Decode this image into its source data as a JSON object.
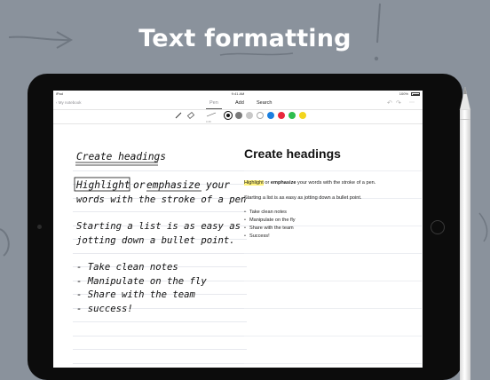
{
  "headline": "Text formatting",
  "statusbar": {
    "device": "iPad",
    "time": "9:41 AM",
    "battery": "100%"
  },
  "navbar": {
    "back_label": "My notebook",
    "tabs": [
      "Pen",
      "Add",
      "Search"
    ]
  },
  "toolbar": {
    "size_label": "0.35",
    "colors": [
      "#111111",
      "#7a7a7a",
      "#c8c8c8",
      "#ffffff",
      "#1a7fe0",
      "#e8283c",
      "#2dbd4e",
      "#f2d51e"
    ]
  },
  "handwriting": {
    "heading": "Create headings",
    "highlight": "Highlight",
    "or": "or",
    "emphasize": "emphasize",
    "line1_rest": "your",
    "line2": "words with the stroke of a pen.",
    "line3": "Starting a list is as easy as",
    "line4": "jotting down a bullet point.",
    "items": [
      "- Take clean notes",
      "- Manipulate on the fly",
      "- Share with the team",
      "- success!"
    ]
  },
  "converted": {
    "heading": "Create headings",
    "highlight": "Highlight",
    "or": " or ",
    "emphasize": "emphasize",
    "p1_rest": " your words with the stroke of a pen.",
    "p2": "Starting a list is as easy as jotting down a bullet point.",
    "items": [
      "Take clean notes",
      "Manipulate on the fly",
      "Share with the team",
      "Success!"
    ]
  }
}
